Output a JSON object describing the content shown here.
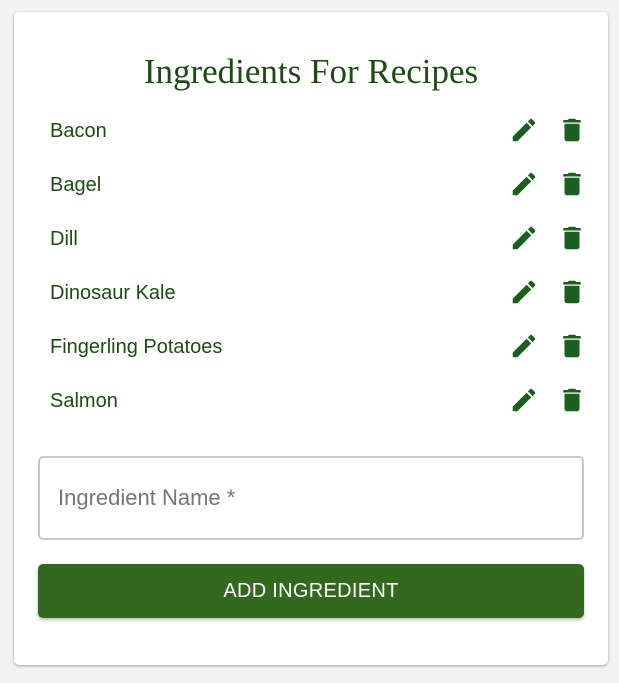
{
  "page": {
    "title": "Ingredients For Recipes"
  },
  "ingredients": [
    {
      "name": "Bacon"
    },
    {
      "name": "Bagel"
    },
    {
      "name": "Dill"
    },
    {
      "name": "Dinosaur Kale"
    },
    {
      "name": "Fingerling Potatoes"
    },
    {
      "name": "Salmon"
    }
  ],
  "form": {
    "input_placeholder": "Ingredient Name *",
    "input_value": "",
    "add_button_label": "ADD INGREDIENT"
  },
  "icons": {
    "edit": "pencil-icon",
    "delete": "trash-icon"
  },
  "colors": {
    "primary_text": "#1b4d12",
    "icon": "#1b5e20",
    "button": "#33691e",
    "button_text": "#ffffff"
  }
}
